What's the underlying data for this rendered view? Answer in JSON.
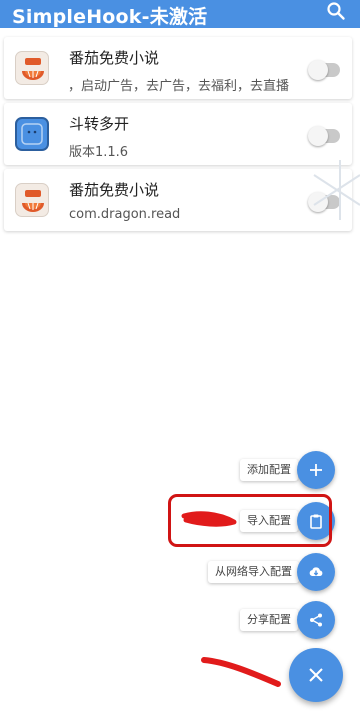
{
  "appbar": {
    "title": "SimpleHook-未激活",
    "search_icon": "search-icon",
    "color": "#4a90e2"
  },
  "apps": [
    {
      "name": "番茄免费小说",
      "subtitle": "告，启动广告，去广告，去福利，去直播",
      "icon": "tomato-novel-icon",
      "enabled": false
    },
    {
      "name": "斗转多开",
      "subtitle": "版本1.1.6",
      "icon": "dual-space-icon",
      "enabled": false
    },
    {
      "name": "番茄免费小说",
      "subtitle": "com.dragon.read",
      "icon": "tomato-novel-icon",
      "enabled": false
    }
  ],
  "fab_menu": {
    "items": [
      {
        "label": "添加配置",
        "icon": "plus-icon"
      },
      {
        "label": "导入配置",
        "icon": "clipboard-icon"
      },
      {
        "label": "从网络导入配置",
        "icon": "cloud-download-icon"
      },
      {
        "label": "分享配置",
        "icon": "share-icon"
      }
    ],
    "main_icon": "close-icon"
  },
  "annotation": {
    "highlight_color": "#d01414"
  }
}
